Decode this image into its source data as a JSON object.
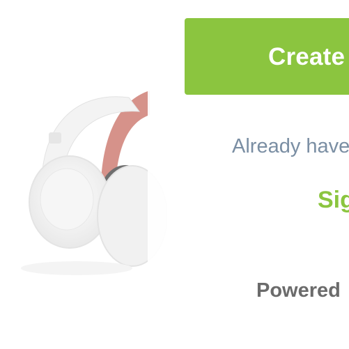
{
  "product_image": {
    "alt": "White headphones",
    "icon": "headphones-image"
  },
  "create_button": {
    "label": "Create"
  },
  "already_account_text": "Already have",
  "sign_in_link": "Sig",
  "powered_by_text": "Powered",
  "colors": {
    "accent_green": "#8bc53f",
    "muted_blue_gray": "#7a8ea3",
    "gray_text": "#6b6b6b"
  }
}
